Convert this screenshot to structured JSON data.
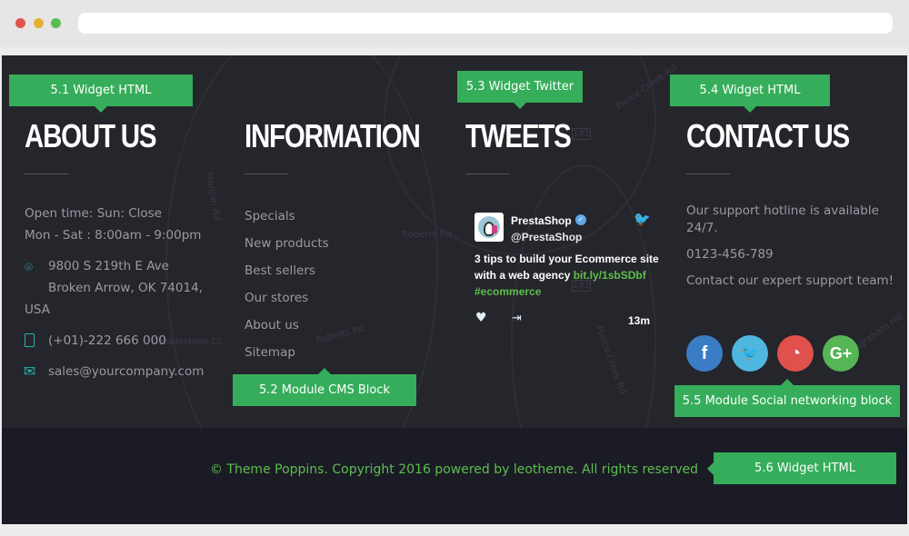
{
  "browser": {
    "dots": [
      "#e0554f",
      "#e3b232",
      "#5cbd4f"
    ]
  },
  "map": {
    "labels": [
      "Morgan Rd",
      "Roberts Rd",
      "Roberts Rd",
      "Cobblestone Ct",
      "Pierce Creek Rd",
      "Pierce Creek Rd",
      "141",
      "141",
      "Ingraham Hill"
    ]
  },
  "annotations": {
    "a1": "5.1 Widget HTML",
    "a2": "5.2 Module CMS Block",
    "a3": "5.3 Widget Twitter",
    "a4": "5.4 Widget HTML",
    "a5": "5.5 Module Social networking block",
    "a6": "5.6 Widget HTML"
  },
  "about": {
    "title": "ABOUT US",
    "hours1": "Open time: Sun: Close",
    "hours2": "Mon - Sat : 8:00am - 9:00pm",
    "addr1": "9800 S 219th E Ave",
    "addr2": "Broken Arrow, OK 74014,",
    "addr3": "USA",
    "phone": "(+01)-222 666 000",
    "email": "sales@yourcompany.com"
  },
  "information": {
    "title": "INFORMATION",
    "links": [
      "Specials",
      "New products",
      "Best sellers",
      "Our stores",
      "About us",
      "Sitemap"
    ]
  },
  "tweets": {
    "title": "TWEETS",
    "name": "PrestaShop",
    "handle": "@PrestaShop",
    "text1": "3 tips to build your Ecommerce site",
    "text2": "with a web agency ",
    "link": "bit.ly/1sbSDbf",
    "hashtag": "#ecommerce",
    "time": "13m"
  },
  "contact": {
    "title": "CONTACT US",
    "line1": "Our support hotline is available",
    "line2": "24/7.",
    "phone": "0123-456-789",
    "line3": "Contact our expert support team!"
  },
  "social": [
    {
      "icon": "facebook-icon",
      "glyph": "f",
      "color": "#3b7dc4"
    },
    {
      "icon": "twitter-icon",
      "glyph": "🐦",
      "color": "#4fb6e0"
    },
    {
      "icon": "rss-icon",
      "glyph": "◔",
      "color": "#e0504c"
    },
    {
      "icon": "google-plus-icon",
      "glyph": "G+",
      "color": "#56b554"
    }
  ],
  "footer": {
    "copyright": "© Theme Poppins. Copyright 2016 powered by leotheme. All rights reserved"
  }
}
